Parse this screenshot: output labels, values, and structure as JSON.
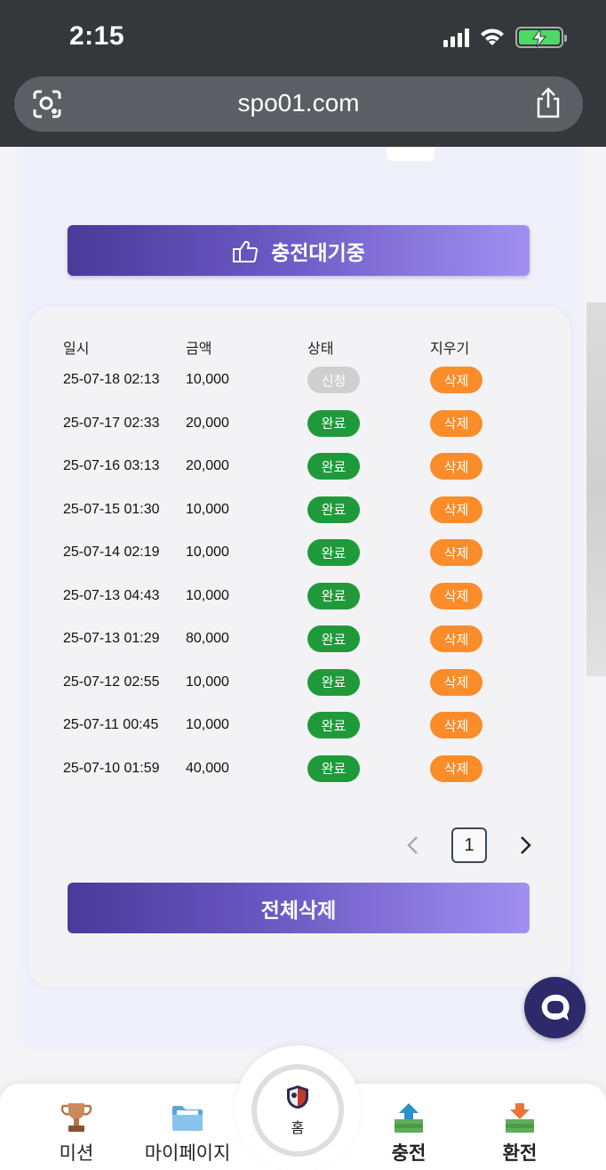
{
  "status_bar": {
    "time": "2:15"
  },
  "browser": {
    "url": "spo01.com"
  },
  "page": {
    "wait_button_label": "충전대기중",
    "table": {
      "headers": [
        "일시",
        "금액",
        "상태",
        "지우기"
      ],
      "rows": [
        {
          "date": "25-07-18 02:13",
          "amount": "10,000",
          "status": "신청",
          "delete": "삭제"
        },
        {
          "date": "25-07-17 02:33",
          "amount": "20,000",
          "status": "완료",
          "delete": "삭제"
        },
        {
          "date": "25-07-16 03:13",
          "amount": "20,000",
          "status": "완료",
          "delete": "삭제"
        },
        {
          "date": "25-07-15 01:30",
          "amount": "10,000",
          "status": "완료",
          "delete": "삭제"
        },
        {
          "date": "25-07-14 02:19",
          "amount": "10,000",
          "status": "완료",
          "delete": "삭제"
        },
        {
          "date": "25-07-13 04:43",
          "amount": "10,000",
          "status": "완료",
          "delete": "삭제"
        },
        {
          "date": "25-07-13 01:29",
          "amount": "80,000",
          "status": "완료",
          "delete": "삭제"
        },
        {
          "date": "25-07-12 02:55",
          "amount": "10,000",
          "status": "완료",
          "delete": "삭제"
        },
        {
          "date": "25-07-11 00:45",
          "amount": "10,000",
          "status": "완료",
          "delete": "삭제"
        },
        {
          "date": "25-07-10 01:59",
          "amount": "40,000",
          "status": "완료",
          "delete": "삭제"
        }
      ]
    },
    "pagination": {
      "current_page": "1",
      "prev_icon": "chevron-left-icon",
      "next_icon": "chevron-right-icon"
    },
    "delete_all_label": "전체삭제"
  },
  "bottom_nav": {
    "items": [
      {
        "label": "미션",
        "icon": "trophy-icon"
      },
      {
        "label": "마이페이지",
        "icon": "folder-icon"
      },
      {
        "label": "홈",
        "icon": "home-logo-icon"
      },
      {
        "label": "충전",
        "icon": "money-up-icon"
      },
      {
        "label": "환전",
        "icon": "money-down-icon"
      }
    ]
  },
  "colors": {
    "status_pending": "#cfcfcf",
    "status_done": "#1f9a3a",
    "delete_button": "#fb8c2a",
    "primary_gradient_start": "#4a3a9a",
    "primary_gradient_end": "#a190f2",
    "chat_fab": "#2c2a6b"
  }
}
